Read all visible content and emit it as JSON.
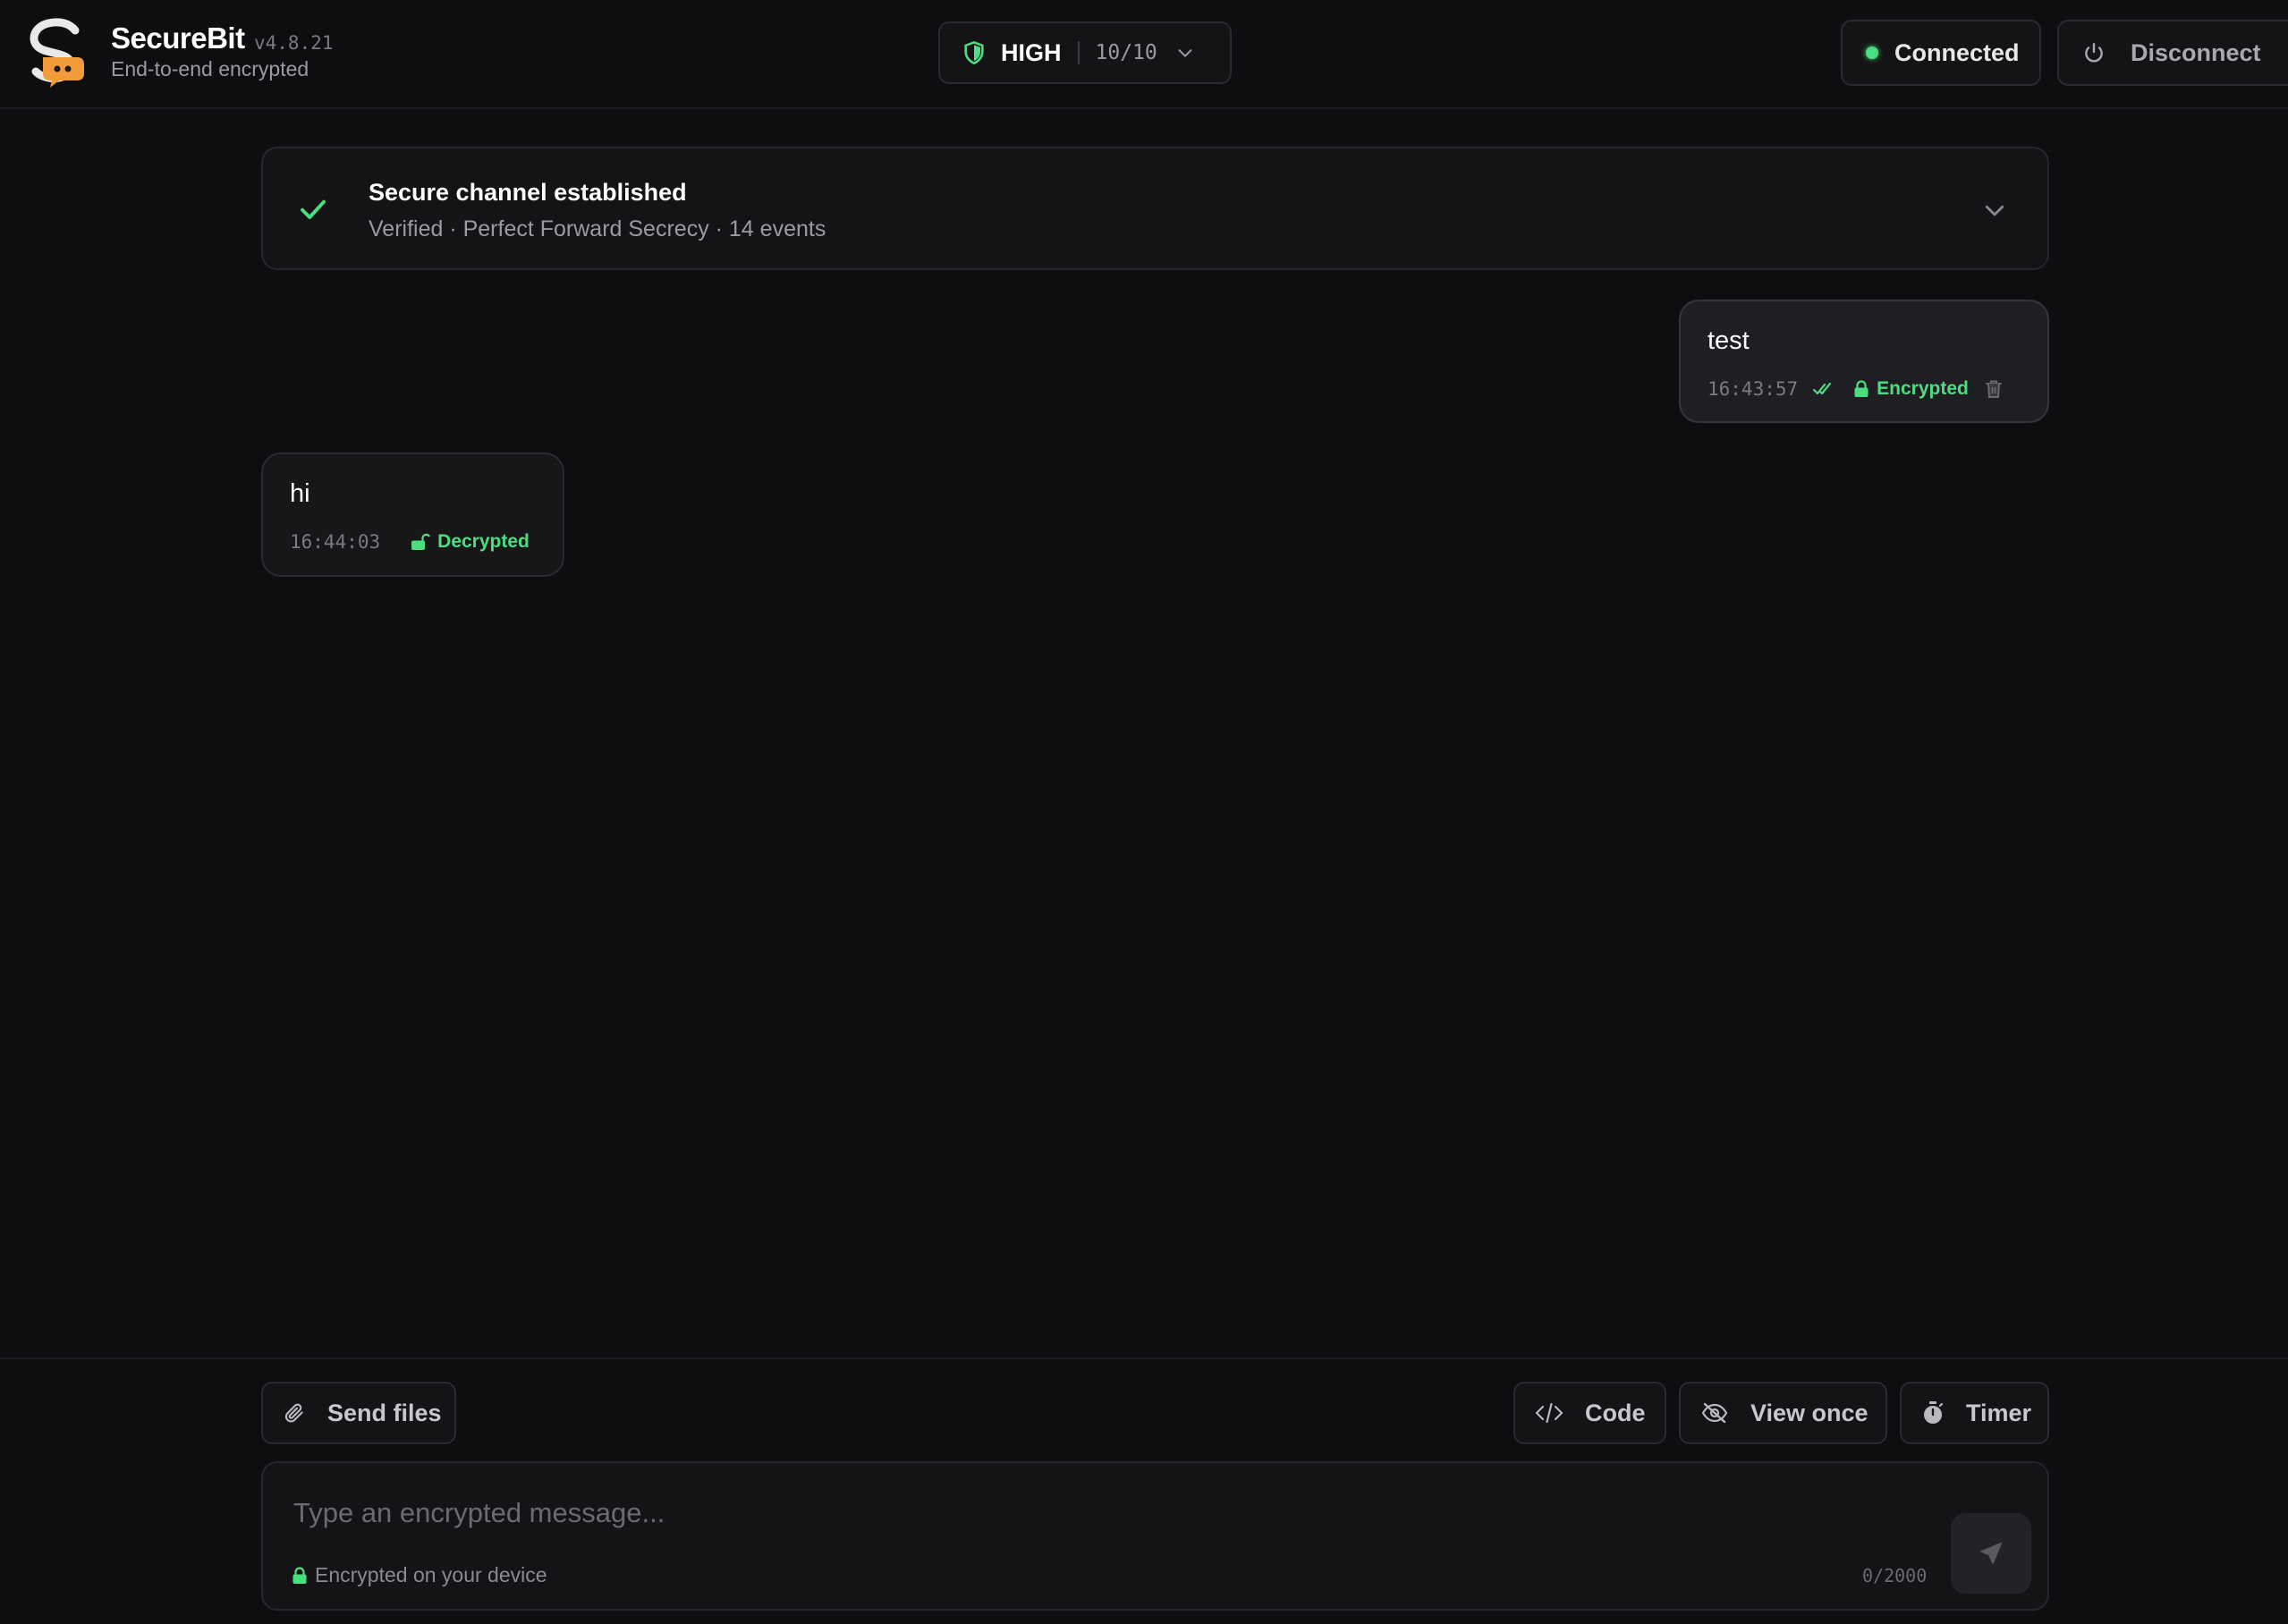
{
  "header": {
    "brand_name": "SecureBit",
    "version": "v4.8.21",
    "subtitle": "End-to-end encrypted",
    "security_level": "HIGH",
    "security_score": "10/10",
    "connection_status": "Connected",
    "disconnect_label": "Disconnect"
  },
  "banner": {
    "title": "Secure channel established",
    "subtitle": "Verified · Perfect Forward Secrecy · 14 events"
  },
  "messages": [
    {
      "direction": "outgoing",
      "text": "test",
      "time": "16:43:57",
      "status": "Encrypted"
    },
    {
      "direction": "incoming",
      "text": "hi",
      "time": "16:44:03",
      "status": "Decrypted"
    }
  ],
  "toolbar": {
    "send_files": "Send files",
    "code": "Code",
    "view_once": "View once",
    "timer": "Timer"
  },
  "composer": {
    "placeholder": "Type an encrypted message...",
    "hint": "Encrypted on your device",
    "char_count": "0/2000"
  },
  "colors": {
    "accent_green": "#4ade80",
    "logo_orange": "#f39a3a",
    "background": "#0e0e10"
  },
  "icons": [
    "logo-icon",
    "shield-icon",
    "chevron-down-icon",
    "status-dot",
    "power-icon",
    "check-icon",
    "double-check-icon",
    "lock-icon",
    "trash-icon",
    "unlock-icon",
    "paperclip-icon",
    "code-icon",
    "eye-off-icon",
    "stopwatch-icon",
    "send-icon"
  ]
}
